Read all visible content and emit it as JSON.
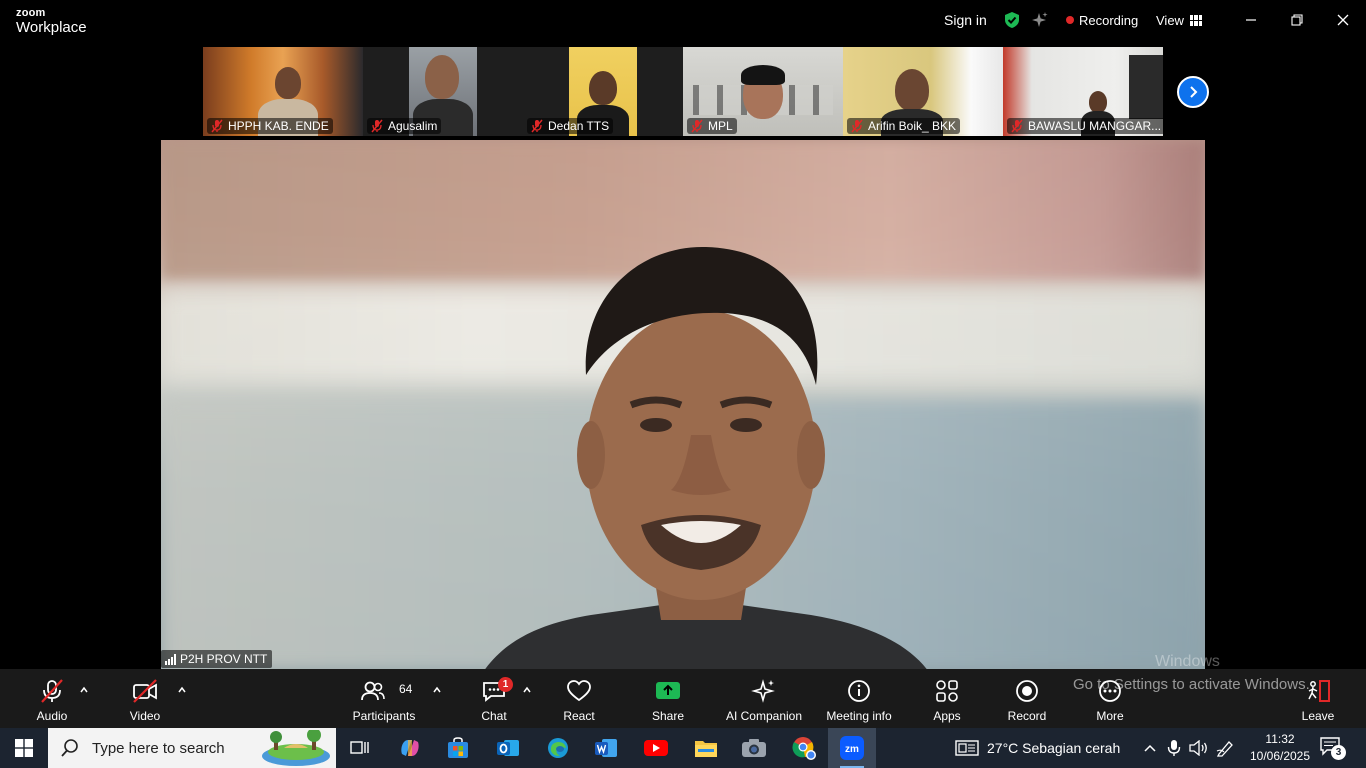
{
  "titlebar": {
    "logo_top": "zoom",
    "logo_bottom": "Workplace",
    "sign_in": "Sign in",
    "recording": "Recording",
    "view": "View",
    "colors": {
      "shield": "#1db954",
      "recording_dot": "#e02828"
    }
  },
  "thumbnails": [
    {
      "name": "HPPH KAB. ENDE"
    },
    {
      "name": "Agusalim"
    },
    {
      "name": "Dedan TTS"
    },
    {
      "name": "MPL"
    },
    {
      "name": "Arifin Boik_ BKK"
    },
    {
      "name": "BAWASLU MANGGAR..."
    }
  ],
  "speaker": {
    "name": "P2H PROV NTT"
  },
  "toolbar": {
    "audio": "Audio",
    "video": "Video",
    "participants": "Participants",
    "participants_count": "64",
    "chat": "Chat",
    "chat_badge": "1",
    "react": "React",
    "share": "Share",
    "ai_companion": "AI Companion",
    "meeting_info": "Meeting info",
    "apps": "Apps",
    "record": "Record",
    "more": "More",
    "leave": "Leave",
    "colors": {
      "share": "#1db954",
      "leave": "#e02828",
      "muted": "#e02828"
    }
  },
  "watermark": {
    "line1": "Windows",
    "line2": "Go to Settings to activate Windows."
  },
  "taskbar": {
    "search_placeholder": "Type here to search",
    "weather": "27°C  Sebagian cerah",
    "time": "11:32",
    "date": "10/06/2025",
    "notification_count": "3",
    "apps": [
      "task-view",
      "copilot",
      "store",
      "outlook",
      "edge",
      "word",
      "youtube",
      "file-explorer",
      "camera",
      "chrome",
      "zoom"
    ]
  }
}
